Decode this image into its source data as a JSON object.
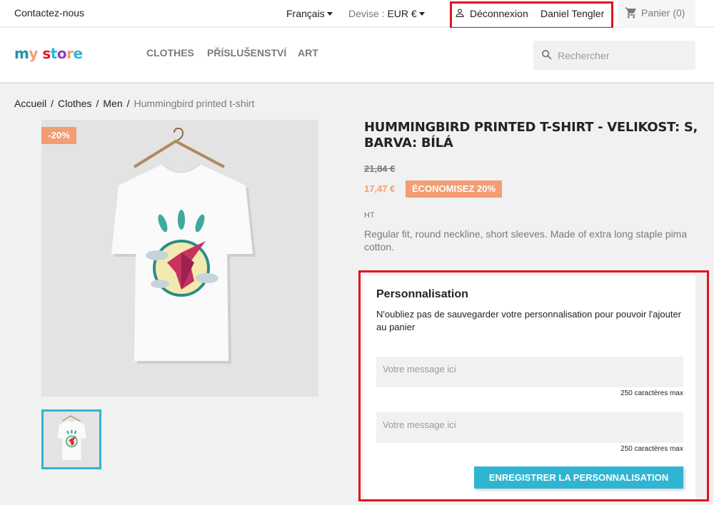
{
  "topbar": {
    "contact": "Contactez-nous",
    "language": "Français",
    "currency_label": "Devise :",
    "currency_value": "EUR €",
    "logout": "Déconnexion",
    "username": "Daniel Tengler",
    "cart": "Panier (0)"
  },
  "header": {
    "logo_text": "my store",
    "nav": [
      "CLOTHES",
      "PŘÍSLUŠENSTVÍ",
      "ART"
    ],
    "search_placeholder": "Rechercher"
  },
  "breadcrumb": [
    "Accueil",
    "Clothes",
    "Men",
    "Hummingbird printed t-shirt"
  ],
  "product": {
    "discount_flag": "-20%",
    "title": "HUMMINGBIRD PRINTED T-SHIRT - VELIKOST: S, BARVA: BÍLÁ",
    "old_price": "21,84 €",
    "price": "17,47 €",
    "save_badge": "ÉCONOMISEZ 20%",
    "tax_label": "HT",
    "description": "Regular fit, round neckline, short sleeves. Made of extra long staple pima cotton."
  },
  "customization": {
    "title": "Personnalisation",
    "note": "N'oubliez pas de sauvegarder votre personnalisation pour pouvoir l'ajouter au panier",
    "fields": [
      {
        "placeholder": "Votre message ici",
        "max": "250 caractères max"
      },
      {
        "placeholder": "Votre message ici",
        "max": "250 caractères max"
      }
    ],
    "save_button": "ENREGISTRER LA PERSONNALISATION"
  },
  "colors": {
    "accent": "#2fb5d2",
    "discount": "#f39d72",
    "highlight_box": "#e3121e"
  }
}
